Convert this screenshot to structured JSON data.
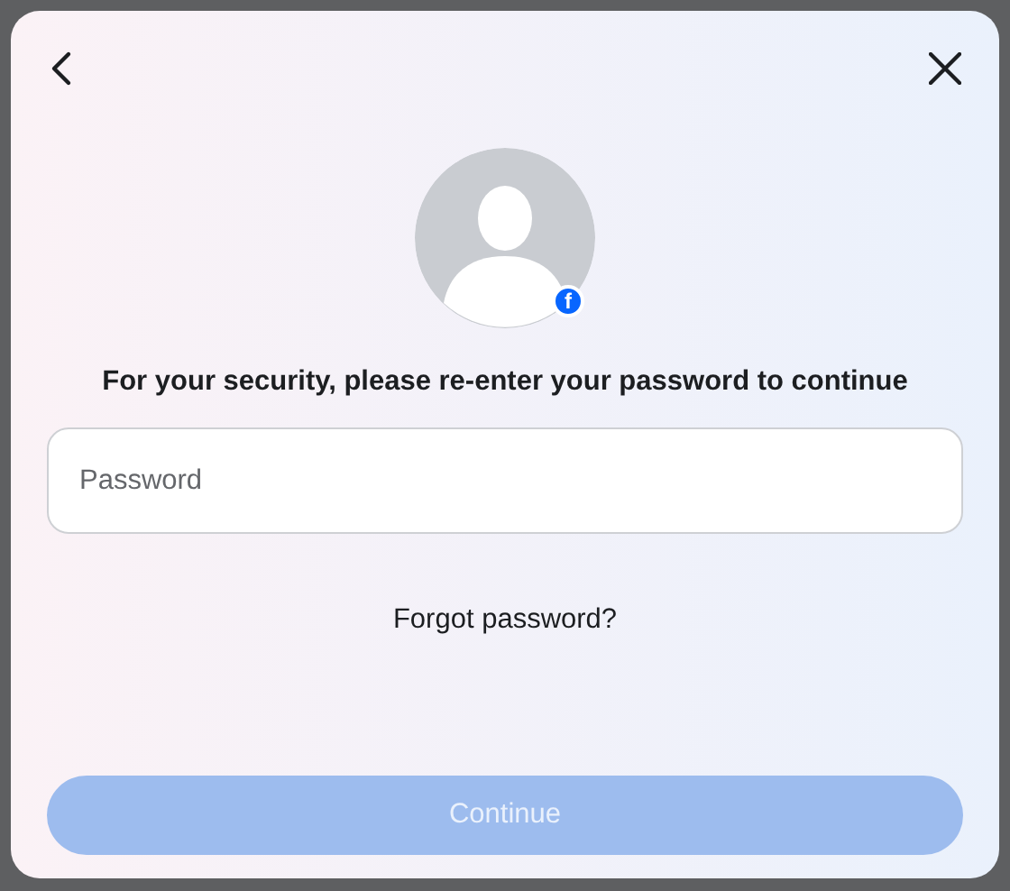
{
  "dialog": {
    "avatar_badge": "f",
    "heading": "For your security, please re-enter your password to continue",
    "password_field": {
      "placeholder": "Password"
    },
    "forgot_link": "Forgot password?",
    "continue_button": {
      "label": "Continue",
      "disabled": true
    }
  }
}
